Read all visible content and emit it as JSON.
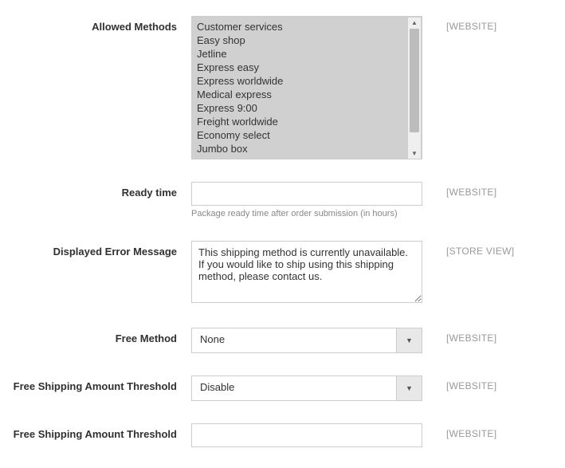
{
  "scope": {
    "website": "[WEBSITE]",
    "store_view": "[STORE VIEW]"
  },
  "fields": {
    "allowed_methods": {
      "label": "Allowed Methods",
      "scope": "website",
      "options": [
        "Customer services",
        "Easy shop",
        "Jetline",
        "Express easy",
        "Express worldwide",
        "Medical express",
        "Express 9:00",
        "Freight worldwide",
        "Economy select",
        "Jumbo box"
      ]
    },
    "ready_time": {
      "label": "Ready time",
      "value": "",
      "scope": "website",
      "help": "Package ready time after order submission (in hours)"
    },
    "error_message": {
      "label": "Displayed Error Message",
      "value": "This shipping method is currently unavailable. If you would like to ship using this shipping method, please contact us.",
      "scope": "store_view"
    },
    "free_method": {
      "label": "Free Method",
      "value": "None",
      "scope": "website"
    },
    "free_threshold_enable": {
      "label": "Free Shipping Amount Threshold",
      "value": "Disable",
      "scope": "website"
    },
    "free_threshold_amount": {
      "label": "Free Shipping Amount Threshold",
      "value": "",
      "scope": "website"
    }
  }
}
